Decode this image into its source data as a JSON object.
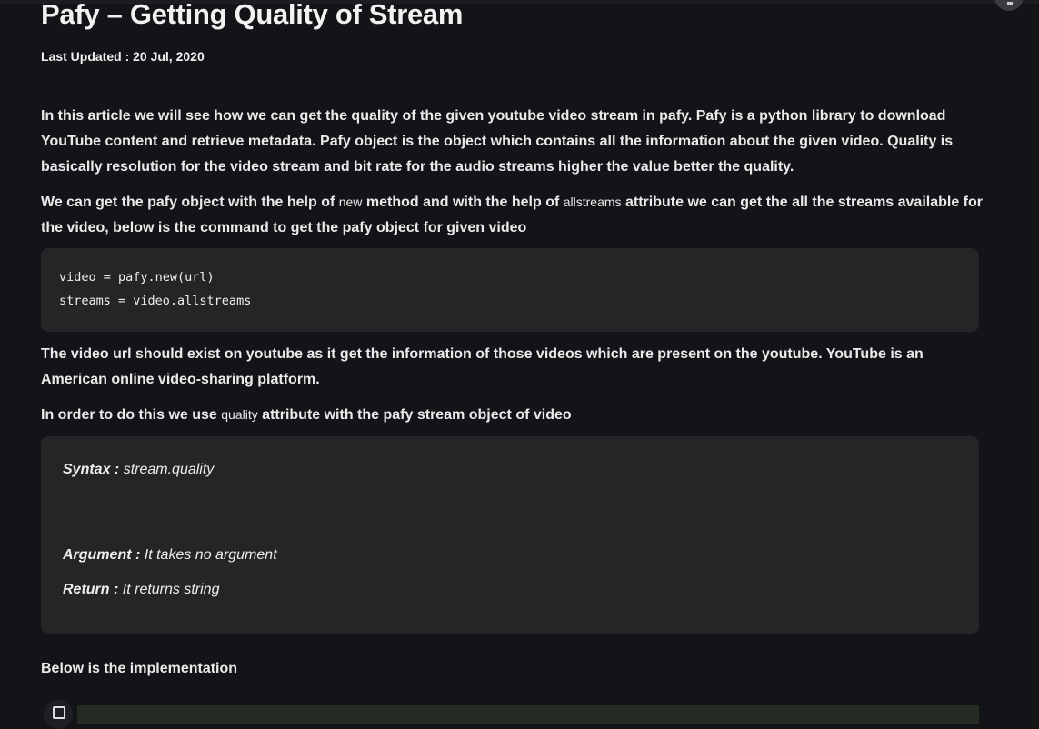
{
  "article": {
    "title": "Pafy – Getting Quality of Stream",
    "last_updated": "Last Updated : 20 Jul, 2020",
    "para1": "In this article we will see how we can get the quality of the given youtube video stream in pafy. Pafy is a python library to download YouTube content and retrieve metadata. Pafy object is the object which contains all the information about the given video. Quality is basically resolution for the video stream and bit rate for the audio streams higher the value better the quality.",
    "para2_a": "We can get the pafy object with the help of ",
    "para2_code1": "new",
    "para2_b": " method and with the help of ",
    "para2_code2": "allstreams",
    "para2_c": " attribute we can get the all the streams available for the video, below is the command to get the pafy object for given video",
    "code_lines": [
      "video = pafy.new(url)",
      "streams = video.allstreams"
    ],
    "para3": "The video url should exist on youtube as it get the information of those videos which are present on the youtube. YouTube is an American online video-sharing platform.",
    "para4_a": "In order to do this we use ",
    "para4_code": "quality",
    "para4_b": " attribute with the pafy stream object of video",
    "syntax_label": "Syntax :",
    "syntax_value": " stream.quality",
    "argument_label": "Argument :",
    "argument_value": " It takes no argument",
    "return_label": "Return :",
    "return_value": " It returns string",
    "impl_heading": "Below is the implementation"
  },
  "icons": {
    "fab": "menu-icon",
    "copy": "copy-icon"
  }
}
